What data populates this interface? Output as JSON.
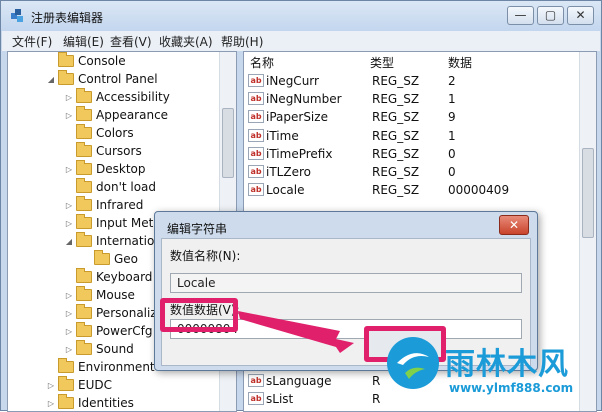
{
  "window": {
    "title": "注册表编辑器",
    "minimize": "—",
    "maximize": "▢",
    "close": "✕"
  },
  "menu": [
    "文件(F)",
    "编辑(E)",
    "查看(V)",
    "收藏夹(A)",
    "帮助(H)"
  ],
  "tree": [
    {
      "label": "Console",
      "arrow": "",
      "indent": 0
    },
    {
      "label": "Control Panel",
      "arrow": "◢",
      "indent": 0
    },
    {
      "label": "Accessibility",
      "arrow": "▷",
      "indent": 1
    },
    {
      "label": "Appearance",
      "arrow": "▷",
      "indent": 1
    },
    {
      "label": "Colors",
      "arrow": "",
      "indent": 1
    },
    {
      "label": "Cursors",
      "arrow": "",
      "indent": 1
    },
    {
      "label": "Desktop",
      "arrow": "▷",
      "indent": 1
    },
    {
      "label": "don't load",
      "arrow": "",
      "indent": 1
    },
    {
      "label": "Infrared",
      "arrow": "▷",
      "indent": 1
    },
    {
      "label": "Input Met",
      "arrow": "▷",
      "indent": 1
    },
    {
      "label": "Internation",
      "arrow": "◢",
      "indent": 1
    },
    {
      "label": "Geo",
      "arrow": "",
      "indent": 2
    },
    {
      "label": "Keyboard",
      "arrow": "",
      "indent": 1
    },
    {
      "label": "Mouse",
      "arrow": "▷",
      "indent": 1
    },
    {
      "label": "Personaliz",
      "arrow": "▷",
      "indent": 1
    },
    {
      "label": "PowerCfg",
      "arrow": "▷",
      "indent": 1
    },
    {
      "label": "Sound",
      "arrow": "▷",
      "indent": 1
    },
    {
      "label": "Environment",
      "arrow": "",
      "indent": 0
    },
    {
      "label": "EUDC",
      "arrow": "▷",
      "indent": 0
    },
    {
      "label": "Identities",
      "arrow": "▷",
      "indent": 0
    }
  ],
  "list": {
    "headers": {
      "name": "名称",
      "type": "类型",
      "data": "数据"
    },
    "icon_text": "ab",
    "rows": [
      {
        "name": "iNegCurr",
        "type": "REG_SZ",
        "data": "2"
      },
      {
        "name": "iNegNumber",
        "type": "REG_SZ",
        "data": "1"
      },
      {
        "name": "iPaperSize",
        "type": "REG_SZ",
        "data": "9"
      },
      {
        "name": "iTime",
        "type": "REG_SZ",
        "data": "1"
      },
      {
        "name": "iTimePrefix",
        "type": "REG_SZ",
        "data": "0"
      },
      {
        "name": "iTLZero",
        "type": "REG_SZ",
        "data": "0"
      },
      {
        "name": "Locale",
        "type": "REG_SZ",
        "data": "00000409"
      }
    ],
    "bottom_rows": [
      {
        "name": "sLanguage",
        "type": "R"
      },
      {
        "name": "sList",
        "type": "R"
      }
    ]
  },
  "dialog": {
    "title": "编辑字符串",
    "close": "✕",
    "name_label": "数值名称(N):",
    "name_value": "Locale",
    "data_label": "数值数据(V):",
    "data_value": "00000804"
  },
  "watermark": {
    "title": "雨林木风",
    "url": "www.ylmf888.com"
  },
  "colors": {
    "highlight": "#e0206a",
    "brand": "#1b9bd8"
  }
}
